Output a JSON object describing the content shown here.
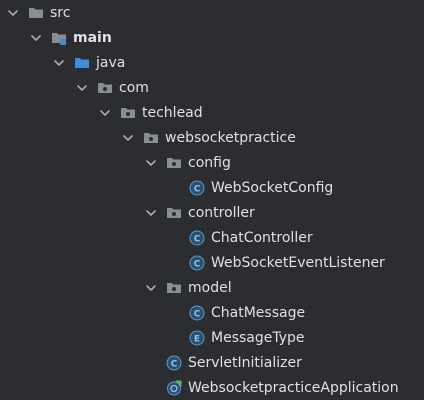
{
  "tree": {
    "rows": [
      {
        "label": "src",
        "depth": 0,
        "icon": "folder-icon",
        "expanded": true,
        "bold": false
      },
      {
        "label": "main",
        "depth": 1,
        "icon": "module-folder-icon",
        "expanded": true,
        "bold": true
      },
      {
        "label": "java",
        "depth": 2,
        "icon": "source-root-folder-icon",
        "expanded": true,
        "bold": false
      },
      {
        "label": "com",
        "depth": 3,
        "icon": "package-icon",
        "expanded": true,
        "bold": false
      },
      {
        "label": "techlead",
        "depth": 4,
        "icon": "package-icon",
        "expanded": true,
        "bold": false
      },
      {
        "label": "websocketpractice",
        "depth": 5,
        "icon": "package-icon",
        "expanded": true,
        "bold": false
      },
      {
        "label": "config",
        "depth": 6,
        "icon": "package-icon",
        "expanded": true,
        "bold": false
      },
      {
        "label": "WebSocketConfig",
        "depth": 7,
        "icon": "class-icon",
        "expanded": null,
        "bold": false
      },
      {
        "label": "controller",
        "depth": 6,
        "icon": "package-icon",
        "expanded": true,
        "bold": false
      },
      {
        "label": "ChatController",
        "depth": 7,
        "icon": "class-icon",
        "expanded": null,
        "bold": false
      },
      {
        "label": "WebSocketEventListener",
        "depth": 7,
        "icon": "class-icon",
        "expanded": null,
        "bold": false
      },
      {
        "label": "model",
        "depth": 6,
        "icon": "package-icon",
        "expanded": true,
        "bold": false
      },
      {
        "label": "ChatMessage",
        "depth": 7,
        "icon": "class-icon",
        "expanded": null,
        "bold": false
      },
      {
        "label": "MessageType",
        "depth": 7,
        "icon": "enum-icon",
        "expanded": null,
        "bold": false
      },
      {
        "label": "ServletInitializer",
        "depth": 6,
        "icon": "class-icon",
        "expanded": null,
        "bold": false
      },
      {
        "label": "WebsocketpracticeApplication",
        "depth": 6,
        "icon": "spring-boot-class-icon",
        "expanded": null,
        "bold": false
      }
    ]
  },
  "colors": {
    "background": "#2b2d30",
    "text": "#dfe1e5",
    "chevron": "#a8abb0",
    "folder": "#8a8d92",
    "source_root_blue": "#3e8ed8",
    "class_fill": "#2e4f6c",
    "class_stroke": "#5a9bd3",
    "class_letter": "#8fc4ee",
    "enum_letter_color": "#8fc4ee",
    "spring_green": "#5fb85f"
  },
  "icon_glyphs": {
    "class_letter": "C",
    "enum_letter": "E"
  }
}
